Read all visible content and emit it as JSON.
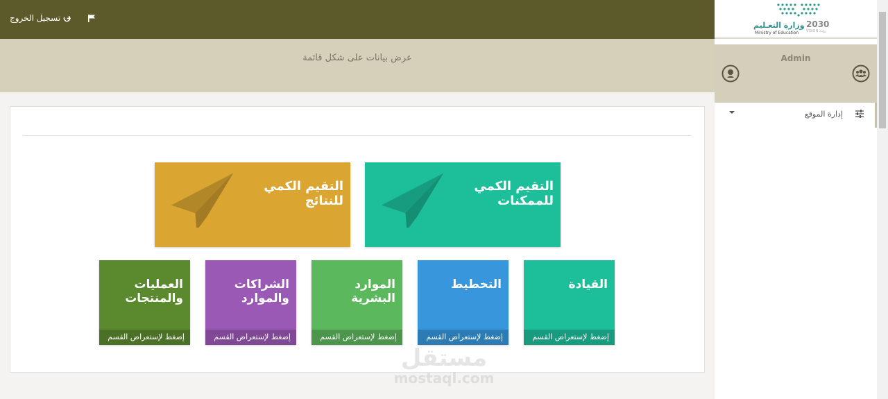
{
  "topbar": {
    "logout_label": "تسجيل الخروج",
    "logout_icon": "sign-out-icon",
    "flag_icon": "flag-icon"
  },
  "subheader": {
    "title": "عرض بيانات على شكل قائمة"
  },
  "tiles_large": [
    {
      "title_line1": "التقيم الكمي",
      "title_line2": "للممكنات",
      "color": "#1dbf9b",
      "icon": "paper-plane-icon"
    },
    {
      "title_line1": "التقيم الكمي",
      "title_line2": "للنتائج",
      "color": "#daa530",
      "icon": "paper-plane-icon"
    }
  ],
  "tiles_small": [
    {
      "title_line1": "القيادة",
      "title_line2": "",
      "footer": "إضغط لإستعراض القسم",
      "color": "#1dbf9b"
    },
    {
      "title_line1": "التخطيط",
      "title_line2": "",
      "footer": "إضغط لإستعراض القسم",
      "color": "#3897dc"
    },
    {
      "title_line1": "الموارد",
      "title_line2": "البشرية",
      "footer": "إضغط لإستعراض القسم",
      "color": "#5cb85c"
    },
    {
      "title_line1": "الشراكات",
      "title_line2": "والموارد",
      "footer": "إضغط لإستعراض القسم",
      "color": "#9b59b6"
    },
    {
      "title_line1": "العمليات",
      "title_line2": "والمنتجات",
      "footer": "إضغط لإستعراض القسم",
      "color": "#5b8a2e"
    }
  ],
  "sidebar": {
    "logo_ar": "وزارة التعـليم",
    "logo_en": "Ministry of Education",
    "logo_year": "2030",
    "logo_sub": "VISION رؤيـة",
    "user_name": "Admin",
    "menu_label": "إدارة الموقع",
    "menu_icon": "sliders-icon"
  },
  "watermark": {
    "ar": "مستقل",
    "en": "mostaql.com"
  }
}
